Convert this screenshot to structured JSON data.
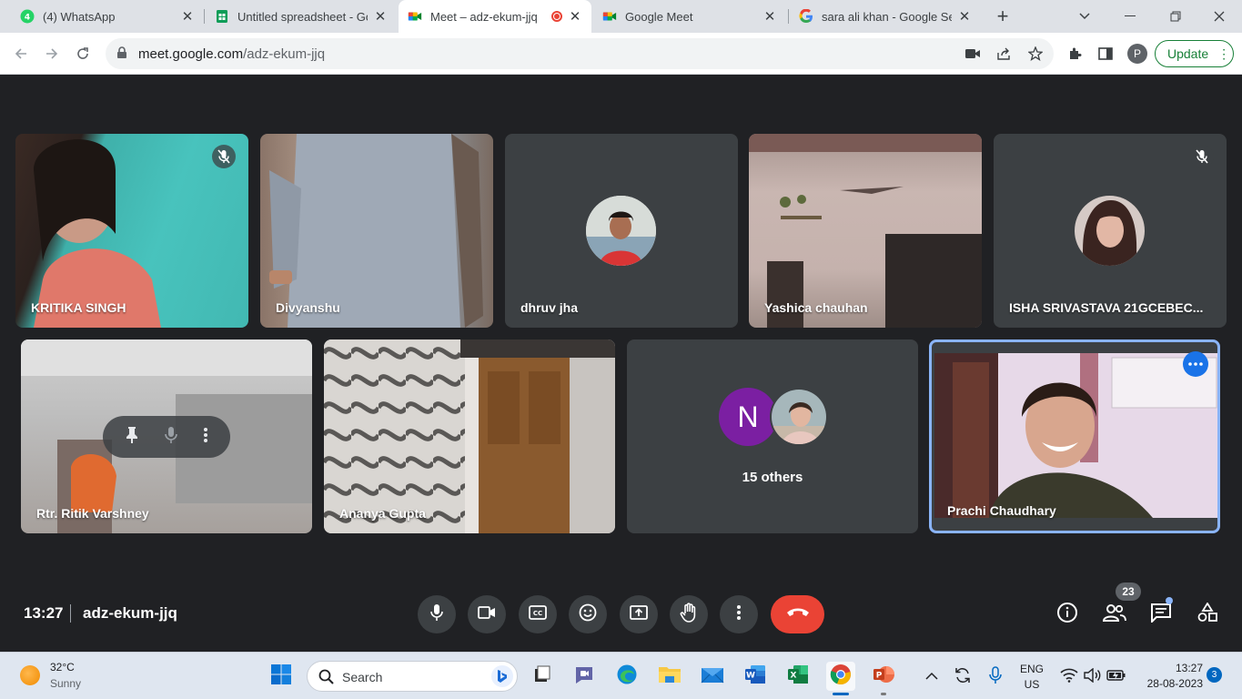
{
  "browser": {
    "tabs": [
      {
        "title": "(4) WhatsApp",
        "favicon": "whatsapp-icon",
        "active": false
      },
      {
        "title": "Untitled spreadsheet - Go",
        "favicon": "sheets-icon",
        "active": false
      },
      {
        "title": "Meet – adz-ekum-jjq",
        "favicon": "meet-icon",
        "active": true,
        "recording": true
      },
      {
        "title": "Google Meet",
        "favicon": "meet-icon",
        "active": false
      },
      {
        "title": "sara ali khan - Google Sea",
        "favicon": "google-icon",
        "active": false
      }
    ],
    "url_host": "meet.google.com",
    "url_path": "/adz-ekum-jjq",
    "profile_initial": "P",
    "update_label": "Update"
  },
  "meet": {
    "participants_row1": [
      {
        "name": "KRITIKA SINGH",
        "muted": true
      },
      {
        "name": "Divyanshu",
        "muted": false
      },
      {
        "name": "dhruv jha",
        "muted": false
      },
      {
        "name": "Yashica chauhan",
        "muted": false
      },
      {
        "name": "ISHA SRIVASTAVA 21GCEBEC...",
        "muted": true
      }
    ],
    "participants_row2": [
      {
        "name": "Rtr. Ritik Varshney"
      },
      {
        "name": "Ananya Gupta"
      },
      {
        "name": "15 others",
        "avatar_initial": "N"
      },
      {
        "name": "Prachi Chaudhary"
      }
    ],
    "time": "13:27",
    "meeting_code": "adz-ekum-jjq",
    "people_count": "23",
    "colors": {
      "bg": "#202124",
      "tile": "#3c4043",
      "end_call": "#ea4335",
      "active_speaker": "#8ab4f8",
      "avatar_n": "#7b1fa2"
    }
  },
  "taskbar": {
    "temperature": "32°C",
    "condition": "Sunny",
    "search_label": "Search",
    "language_line1": "ENG",
    "language_line2": "US",
    "clock_time": "13:27",
    "clock_date": "28-08-2023",
    "notifications": "3"
  }
}
